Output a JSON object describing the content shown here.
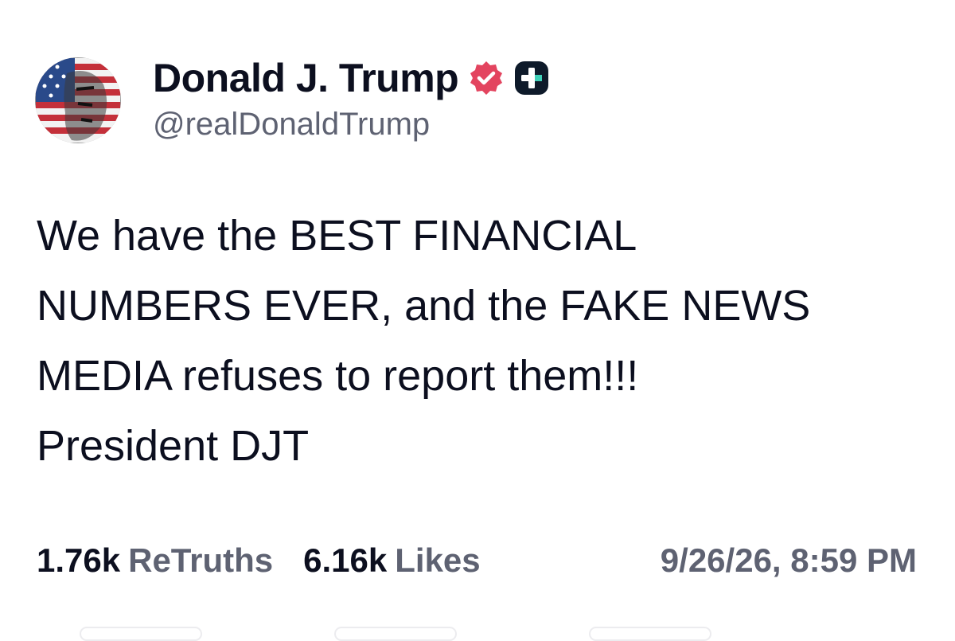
{
  "author": {
    "display_name": "Donald J. Trump",
    "handle": "@realDonaldTrump",
    "avatar_icon": "flag-portrait-avatar",
    "verified_icon": "verified-badge-icon",
    "verified_color": "#e3445f",
    "plus_icon": "plus-badge-icon"
  },
  "post": {
    "lines": [
      "We have the BEST FINANCIAL",
      "NUMBERS EVER, and the FAKE NEWS",
      "MEDIA refuses to report them!!!",
      "President DJT"
    ]
  },
  "stats": {
    "retruths_count": "1.76k",
    "retruths_label": "ReTruths",
    "likes_count": "6.16k",
    "likes_label": "Likes",
    "timestamp": "9/26/26, 8:59 PM"
  },
  "colors": {
    "text_primary": "#0c0f1f",
    "text_secondary": "#5e6272",
    "background": "#ffffff"
  }
}
